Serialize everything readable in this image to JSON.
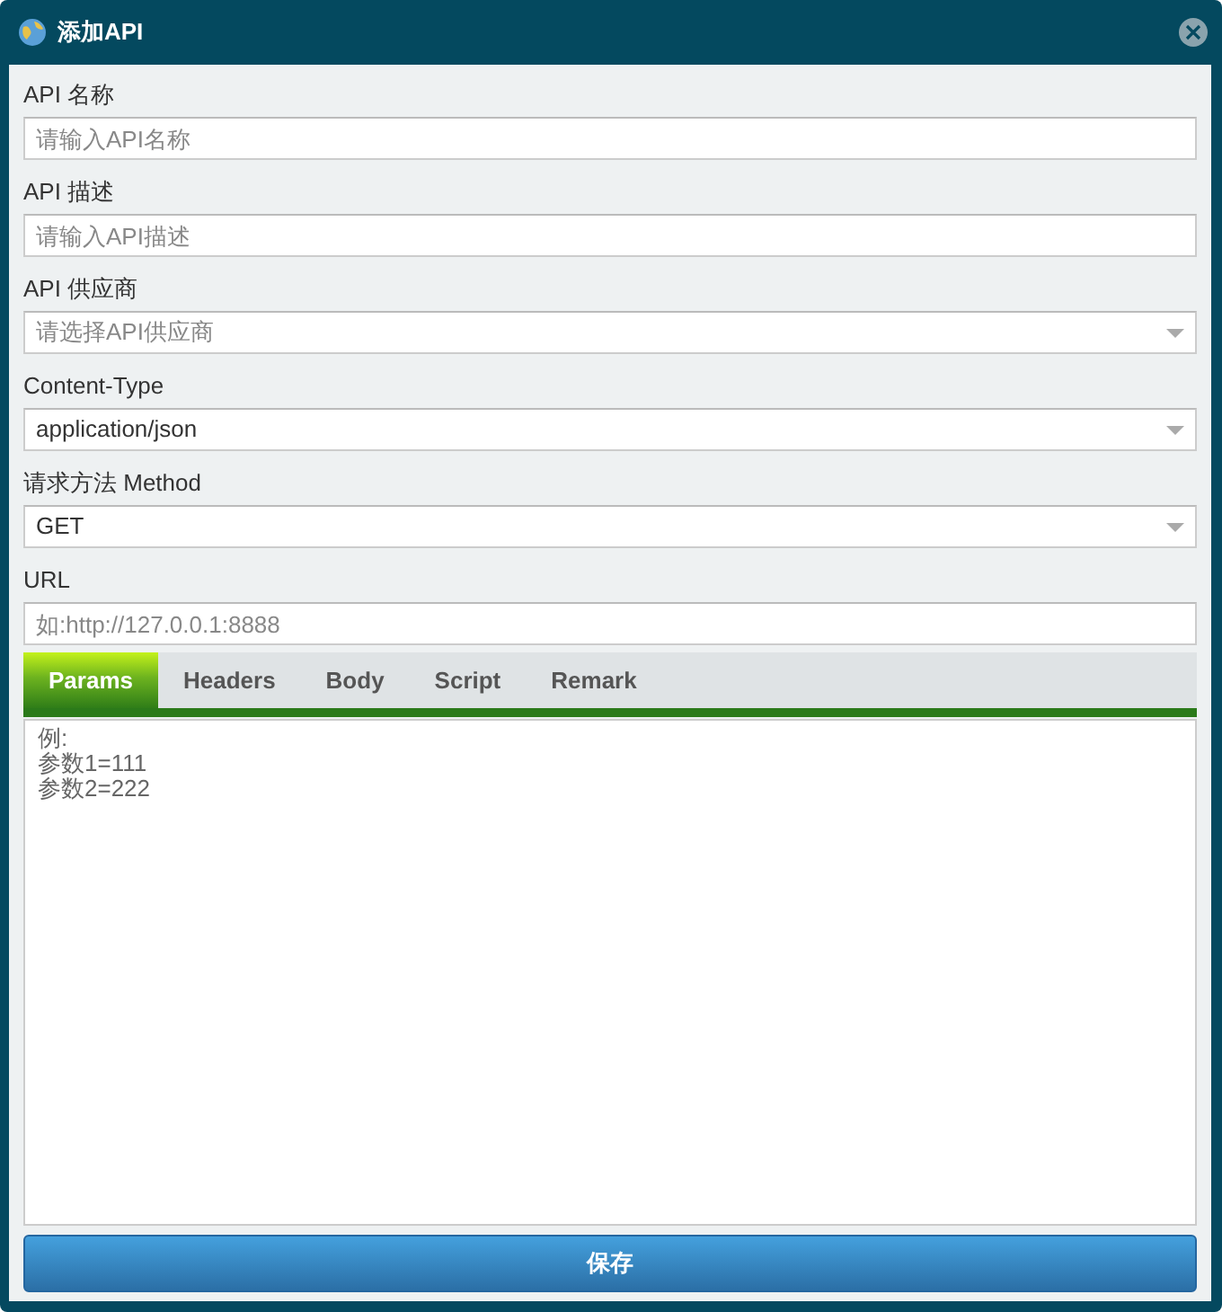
{
  "window": {
    "title": "添加API"
  },
  "fields": [
    {
      "label": "API 名称",
      "kind": "input",
      "placeholder": "请输入API名称"
    },
    {
      "label": "API 描述",
      "kind": "input",
      "placeholder": "请输入API描述"
    },
    {
      "label": "API 供应商",
      "kind": "select",
      "placeholder": "请选择API供应商"
    },
    {
      "label": "Content-Type",
      "kind": "select",
      "value": "application/json"
    },
    {
      "label": "请求方法 Method",
      "kind": "select",
      "value": "GET"
    },
    {
      "label": "URL",
      "kind": "input",
      "placeholder": "如:http://127.0.0.1:8888"
    }
  ],
  "tabs": [
    {
      "label": "Params",
      "selected": true
    },
    {
      "label": "Headers",
      "selected": false
    },
    {
      "label": "Body",
      "selected": false
    },
    {
      "label": "Script",
      "selected": false
    },
    {
      "label": "Remark",
      "selected": false
    }
  ],
  "editor": {
    "placeholder": "例:\n参数1=111\n参数2=222"
  },
  "save_button": {
    "label": "保存"
  }
}
